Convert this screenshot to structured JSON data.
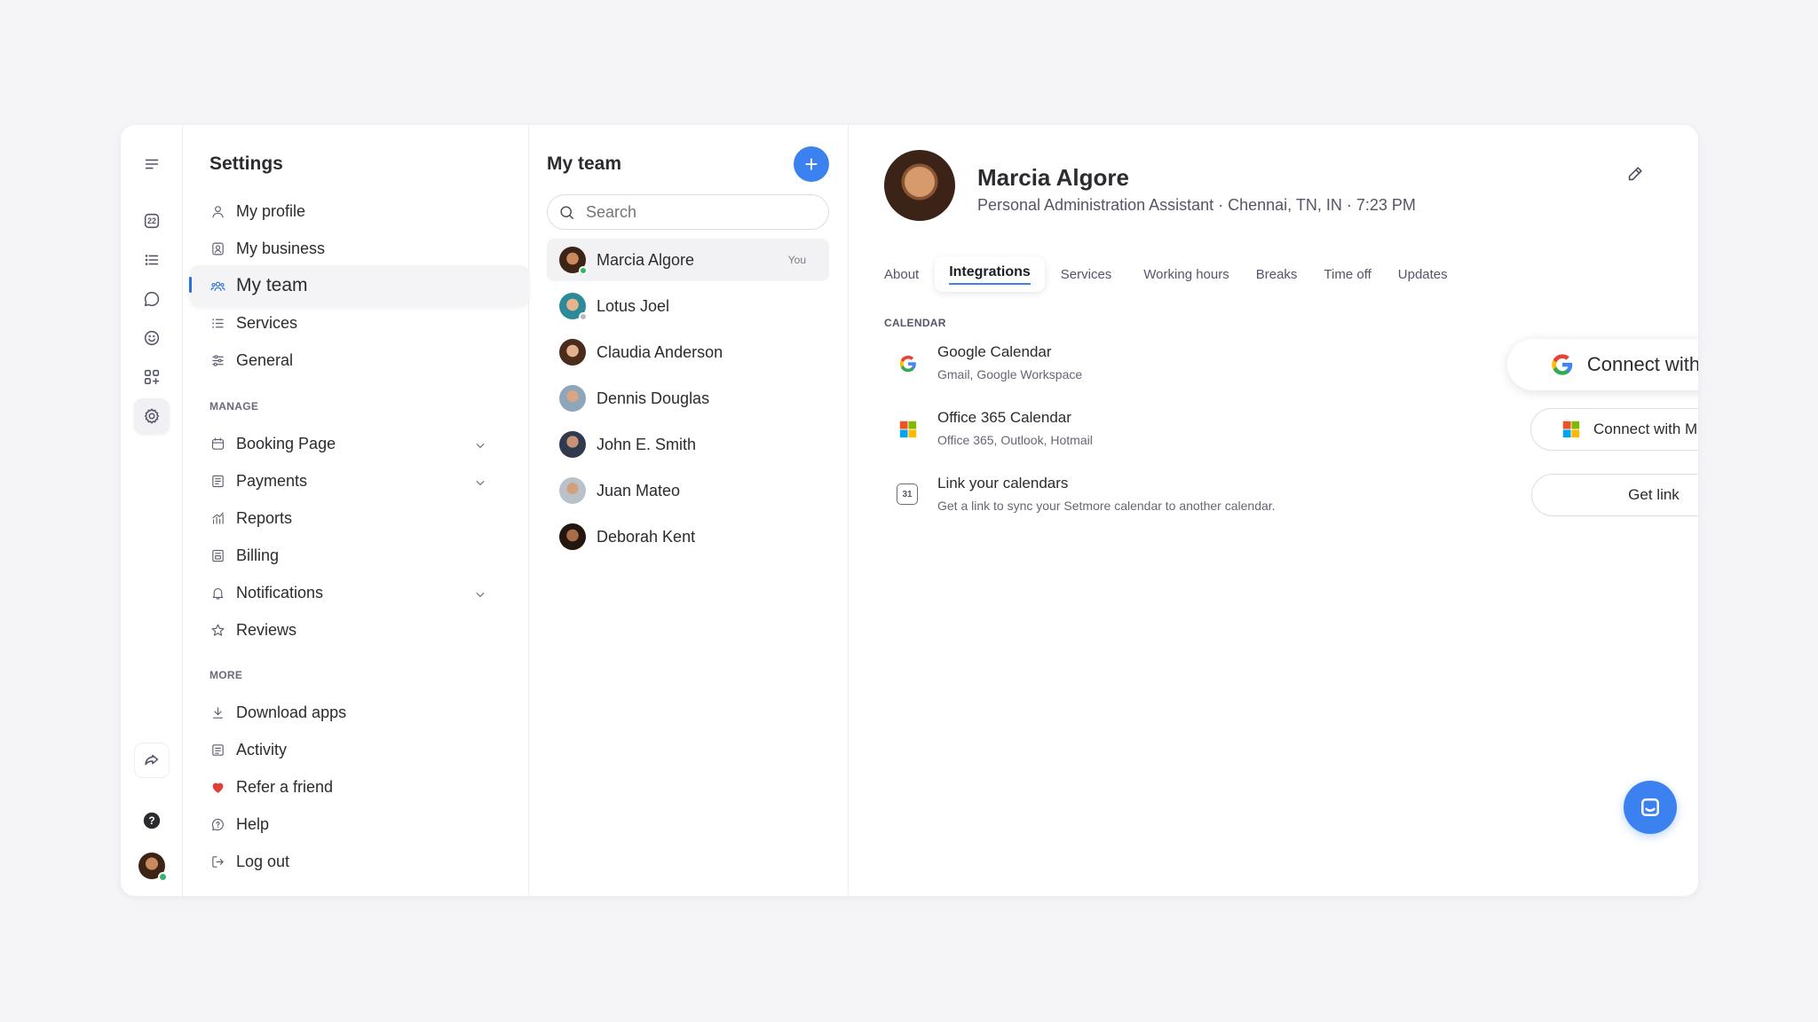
{
  "colors": {
    "accent": "#3b82f0",
    "online": "#34b36a",
    "away": "#b8b8c4",
    "heart": "#e0403a"
  },
  "rail": {
    "icons": [
      "menu-icon",
      "calendar-icon",
      "list-icon",
      "chat-icon",
      "smiley-icon",
      "apps-icon",
      "gear-icon",
      "share-icon",
      "help-icon"
    ],
    "calendar_day": "22"
  },
  "settings": {
    "title": "Settings",
    "items": [
      {
        "label": "My profile",
        "icon": "person-icon"
      },
      {
        "label": "My business",
        "icon": "business-icon"
      },
      {
        "label": "My team",
        "icon": "team-icon"
      },
      {
        "label": "Services",
        "icon": "list-icon"
      },
      {
        "label": "General",
        "icon": "sliders-icon"
      }
    ],
    "manage_label": "MANAGE",
    "manage": [
      {
        "label": "Booking Page",
        "icon": "calendar-icon"
      },
      {
        "label": "Payments",
        "icon": "receipt-icon"
      },
      {
        "label": "Reports",
        "icon": "chart-icon"
      },
      {
        "label": "Billing",
        "icon": "billing-icon"
      },
      {
        "label": "Notifications",
        "icon": "bell-icon"
      },
      {
        "label": "Reviews",
        "icon": "star-icon"
      }
    ],
    "more_label": "MORE",
    "more": [
      {
        "label": "Download apps",
        "icon": "download-icon"
      },
      {
        "label": "Activity",
        "icon": "activity-icon"
      },
      {
        "label": "Refer a friend",
        "icon": "heart-icon"
      },
      {
        "label": "Help",
        "icon": "help-icon"
      },
      {
        "label": "Log out",
        "icon": "logout-icon"
      }
    ]
  },
  "team": {
    "title": "My team",
    "add_label": "+",
    "search_placeholder": "Search",
    "members": [
      {
        "name": "Marcia Algore",
        "badge": "You",
        "status": "online"
      },
      {
        "name": "Lotus Joel",
        "status": "away"
      },
      {
        "name": "Claudia Anderson"
      },
      {
        "name": "Dennis Douglas"
      },
      {
        "name": "John E. Smith"
      },
      {
        "name": "Juan Mateo"
      },
      {
        "name": "Deborah Kent"
      }
    ]
  },
  "profile": {
    "name": "Marcia Algore",
    "subtitle": "Personal Administration Assistant · Chennai, TN, IN · 7:23 PM",
    "tabs": [
      "About",
      "Integrations",
      "Services",
      "Working hours",
      "Breaks",
      "Time off",
      "Updates"
    ],
    "active_tab": "Integrations",
    "calendar_label": "CALENDAR",
    "integrations": [
      {
        "title": "Google Calendar",
        "desc": "Gmail, Google Workspace",
        "action": "Connect with Google",
        "icon": "google-icon"
      },
      {
        "title": "Office 365 Calendar",
        "desc": "Office 365, Outlook, Hotmail",
        "action": "Connect with Microsoft",
        "icon": "microsoft-icon"
      },
      {
        "title": "Link your calendars",
        "desc": "Get a link to sync your Setmore calendar to another calendar.",
        "action": "Get link",
        "icon": "calendar-31-icon",
        "icon_text": "31"
      }
    ]
  }
}
